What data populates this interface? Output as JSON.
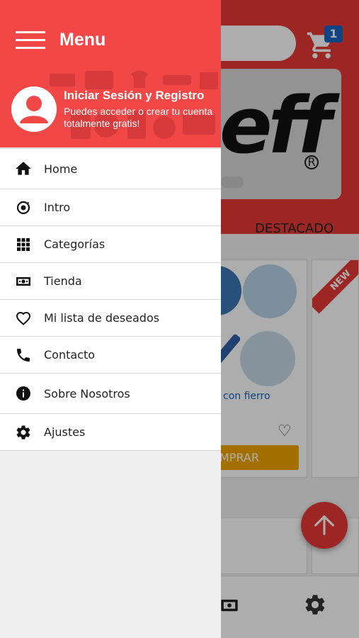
{
  "background": {
    "cart_count": "1",
    "tab_label": "DESTACADO",
    "product_link": "con fierro",
    "buy_label": "MPRAR",
    "new_badge": "NEW"
  },
  "drawer": {
    "title": "Menu",
    "login_title": "Iniciar Sesión y Registro",
    "login_subtitle": "Puedes acceder o crear tu cuenta totalmente gratis!",
    "items": [
      {
        "label": "Home",
        "icon": "home-icon"
      },
      {
        "label": "Intro",
        "icon": "intro-icon"
      },
      {
        "label": "Categorías",
        "icon": "grid-icon"
      },
      {
        "label": "Tienda",
        "icon": "store-icon"
      },
      {
        "label": "Mi lista de deseados",
        "icon": "heart-icon"
      },
      {
        "label": "Contacto",
        "icon": "phone-icon"
      },
      {
        "label": "Sobre Nosotros",
        "icon": "info-icon"
      },
      {
        "label": "Ajustes",
        "icon": "settings-icon"
      }
    ]
  },
  "colors": {
    "primary_red": "#f24747",
    "accent_blue": "#1565c0",
    "buy_orange": "#f0a500"
  }
}
